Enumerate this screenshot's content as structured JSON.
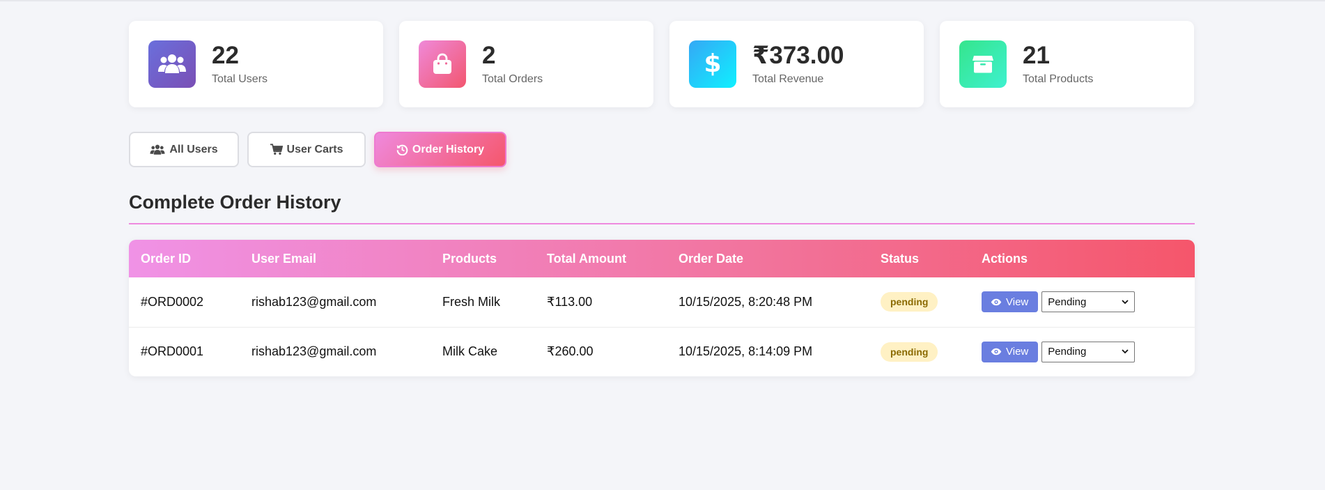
{
  "stats": [
    {
      "value": "22",
      "label": "Total Users",
      "icon": "users-icon"
    },
    {
      "value": "2",
      "label": "Total Orders",
      "icon": "shopping-bag-icon"
    },
    {
      "value": "₹373.00",
      "label": "Total Revenue",
      "icon": "dollar-icon"
    },
    {
      "value": "21",
      "label": "Total Products",
      "icon": "box-icon"
    }
  ],
  "tabs": [
    {
      "label": "All Users",
      "icon": "users-icon",
      "active": false
    },
    {
      "label": "User Carts",
      "icon": "cart-icon",
      "active": false
    },
    {
      "label": "Order History",
      "icon": "history-icon",
      "active": true
    }
  ],
  "section": {
    "title": "Complete Order History"
  },
  "table": {
    "headers": [
      "Order ID",
      "User Email",
      "Products",
      "Total Amount",
      "Order Date",
      "Status",
      "Actions"
    ],
    "rows": [
      {
        "order_id": "#ORD0002",
        "email": "rishab123@gmail.com",
        "products": "Fresh Milk",
        "amount": "₹113.00",
        "date": "10/15/2025, 8:20:48 PM",
        "status": "pending",
        "view_label": "View",
        "select_value": "Pending"
      },
      {
        "order_id": "#ORD0001",
        "email": "rishab123@gmail.com",
        "products": "Milk Cake",
        "amount": "₹260.00",
        "date": "10/15/2025, 8:14:09 PM",
        "status": "pending",
        "view_label": "View",
        "select_value": "Pending"
      }
    ]
  },
  "colors": {
    "accent_gradient_start": "#f093fb",
    "accent_gradient_end": "#f5576c",
    "view_button": "#6a7ee0",
    "status_pending_bg": "#fff1c4"
  }
}
